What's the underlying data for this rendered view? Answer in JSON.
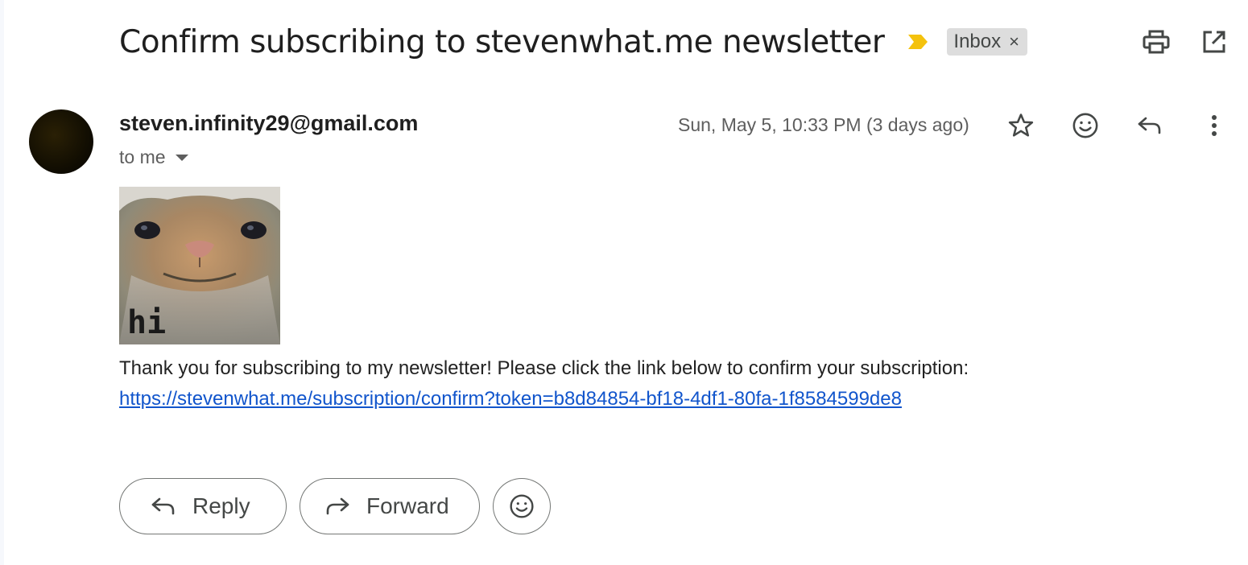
{
  "email": {
    "subject": "Confirm subscribing to stevenwhat.me newsletter",
    "label": "Inbox",
    "label_close": "×",
    "sender": "steven.infinity29@gmail.com",
    "recipient": "to me",
    "date": "Sun, May 5, 10:33 PM (3 days ago)",
    "image_caption": "hi",
    "body_text": "Thank you for subscribing to my newsletter! Please click the link below to confirm your subscription:",
    "confirm_link": "https://stevenwhat.me/subscription/confirm?token=b8d84854-bf18-4df1-80fa-1f8584599de8"
  },
  "actions": {
    "reply_label": "Reply",
    "forward_label": "Forward"
  },
  "icons": {
    "importance": "importance-marker-icon",
    "print": "print-icon",
    "open_new_window": "open-in-new-icon",
    "star": "star-icon",
    "emoji": "emoji-icon",
    "reply": "reply-icon",
    "more": "more-vert-icon",
    "forward": "forward-icon"
  },
  "colors": {
    "importance_marker": "#f4c20d",
    "link": "#1155cc",
    "chip_bg": "#dddddd"
  }
}
